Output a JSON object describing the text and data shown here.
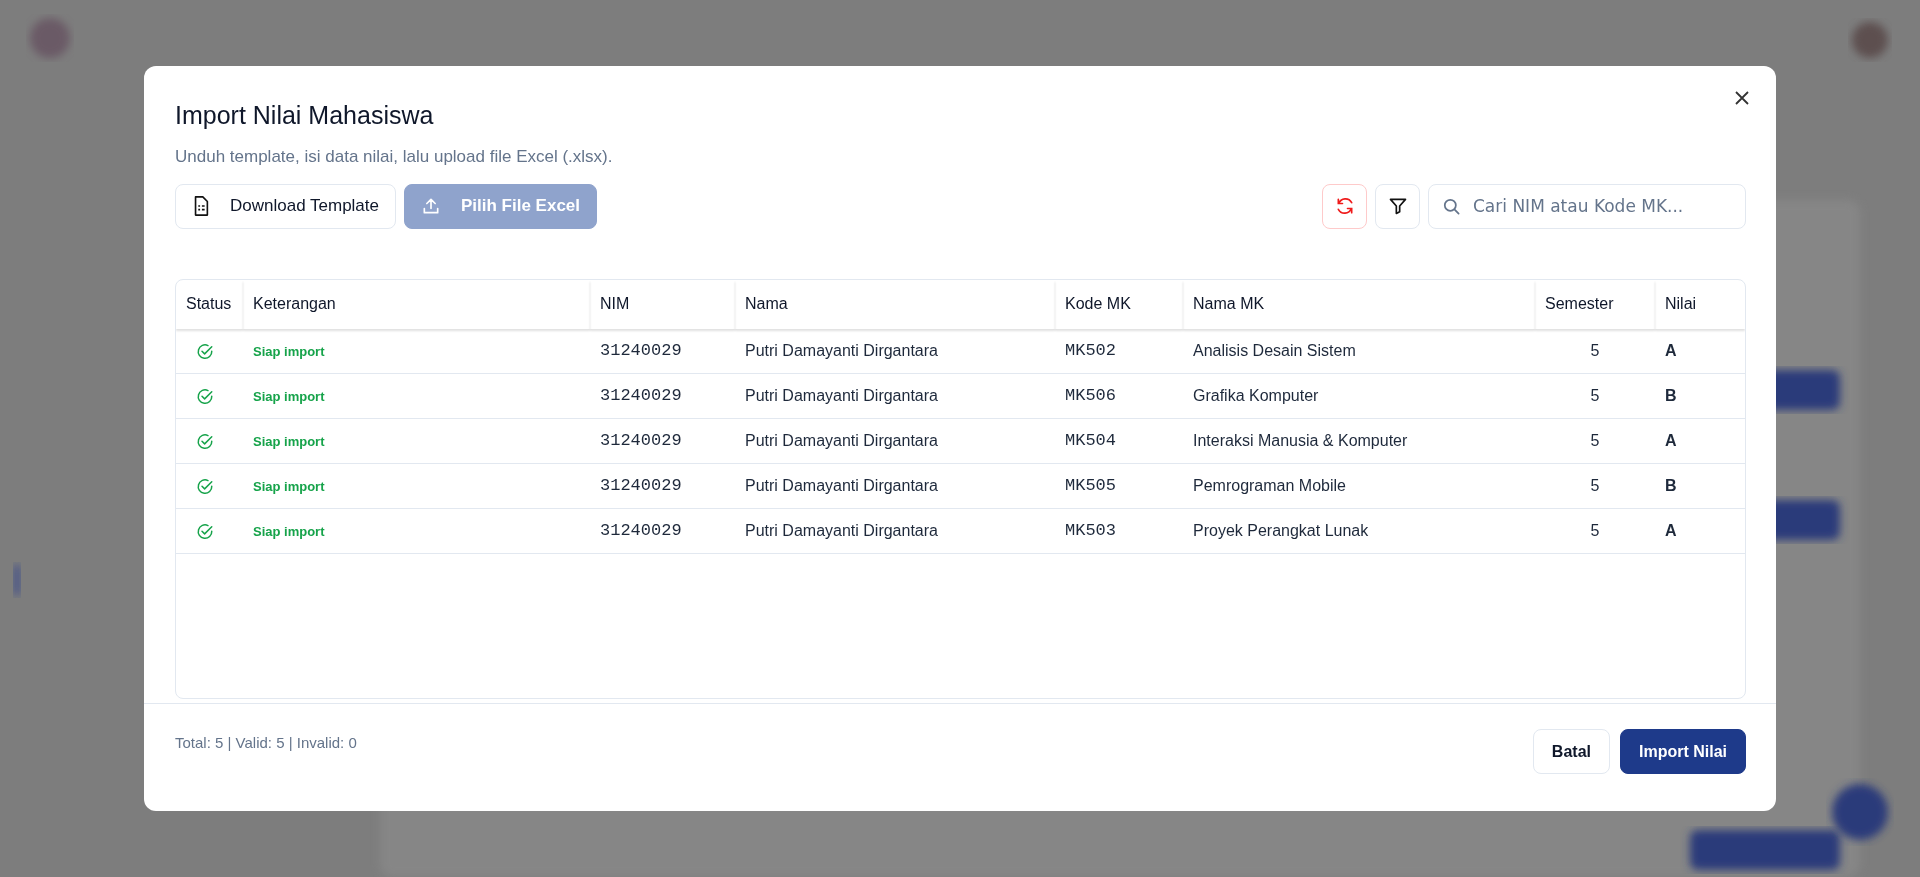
{
  "modal": {
    "title": "Import Nilai Mahasiswa",
    "subtitle": "Unduh template, isi data nilai, lalu upload file Excel (.xlsx).",
    "actions": [
      {
        "label": "Download Template",
        "kind": "download",
        "disabled": false
      },
      {
        "label": "Pilih File Excel",
        "kind": "upload",
        "disabled": true
      }
    ],
    "search": {
      "placeholder": "Cari NIM atau Kode MK..."
    },
    "table": {
      "columns": [
        "Status",
        "Keterangan",
        "NIM",
        "Nama",
        "Kode MK",
        "Nama MK",
        "Semester",
        "Nilai"
      ],
      "rows": [
        {
          "valid": true,
          "keterangan": "Siap import",
          "nim": "31240029",
          "nama": "Putri Damayanti Dirgantara",
          "kode_mk": "MK502",
          "nama_mk": "Analisis Desain Sistem",
          "semester": "5",
          "nilai": "A"
        },
        {
          "valid": true,
          "keterangan": "Siap import",
          "nim": "31240029",
          "nama": "Putri Damayanti Dirgantara",
          "kode_mk": "MK506",
          "nama_mk": "Grafika Komputer",
          "semester": "5",
          "nilai": "B"
        },
        {
          "valid": true,
          "keterangan": "Siap import",
          "nim": "31240029",
          "nama": "Putri Damayanti Dirgantara",
          "kode_mk": "MK504",
          "nama_mk": "Interaksi Manusia & Komputer",
          "semester": "5",
          "nilai": "A"
        },
        {
          "valid": true,
          "keterangan": "Siap import",
          "nim": "31240029",
          "nama": "Putri Damayanti Dirgantara",
          "kode_mk": "MK505",
          "nama_mk": "Pemrograman Mobile",
          "semester": "5",
          "nilai": "B"
        },
        {
          "valid": true,
          "keterangan": "Siap import",
          "nim": "31240029",
          "nama": "Putri Damayanti Dirgantara",
          "kode_mk": "MK503",
          "nama_mk": "Proyek Perangkat Lunak",
          "semester": "5",
          "nilai": "A"
        }
      ]
    },
    "summary": "Total: 5 | Valid: 5 | Invalid: 0",
    "footer_buttons": [
      {
        "label": "Batal",
        "kind": "cancel"
      },
      {
        "label": "Import Nilai",
        "kind": "primary"
      }
    ]
  }
}
